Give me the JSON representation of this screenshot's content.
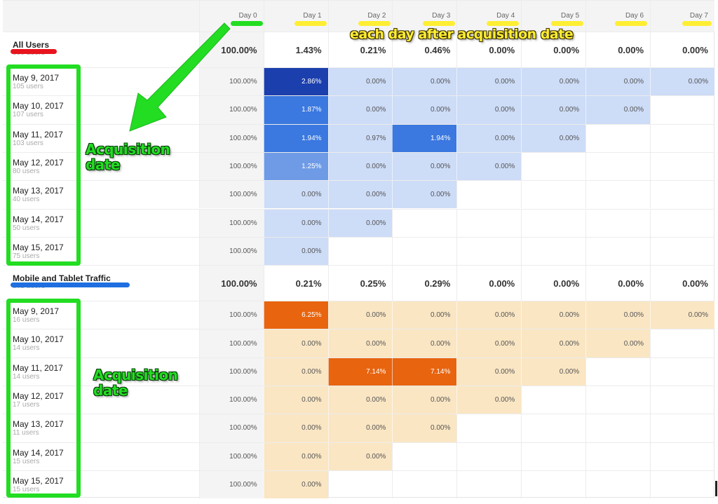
{
  "colors": {
    "blue_light": "#cddcf7",
    "blue_mid": "#6f9be6",
    "blue_strong": "#3b78e0",
    "blue_dark": "#1c3fae",
    "orange_light": "#fae6c3",
    "orange_strong": "#e8640f",
    "highlight_green": "#22dd22",
    "highlight_yellow": "#ffee33",
    "highlight_red": "#e8141e",
    "highlight_blue": "#1f6fe0"
  },
  "header": {
    "days": [
      "Day 0",
      "Day 1",
      "Day 2",
      "Day 3",
      "Day 4",
      "Day 5",
      "Day 6",
      "Day 7"
    ]
  },
  "segments": [
    {
      "title": "All Users",
      "users": "560 users",
      "summary": [
        "100.00%",
        "1.43%",
        "0.21%",
        "0.46%",
        "0.00%",
        "0.00%",
        "0.00%",
        "0.00%"
      ],
      "rows": [
        {
          "date": "May 9, 2017",
          "users": "105 users",
          "values": [
            "100.00%",
            "2.86%",
            "0.00%",
            "0.00%",
            "0.00%",
            "0.00%",
            "0.00%",
            "0.00%"
          ],
          "shades": [
            "",
            "dark",
            "light",
            "light",
            "light",
            "light",
            "light",
            "light"
          ]
        },
        {
          "date": "May 10, 2017",
          "users": "107 users",
          "values": [
            "100.00%",
            "1.87%",
            "0.00%",
            "0.00%",
            "0.00%",
            "0.00%",
            "0.00%"
          ],
          "shades": [
            "",
            "strong",
            "light",
            "light",
            "light",
            "light",
            "light"
          ]
        },
        {
          "date": "May 11, 2017",
          "users": "103 users",
          "values": [
            "100.00%",
            "1.94%",
            "0.97%",
            "1.94%",
            "0.00%",
            "0.00%"
          ],
          "shades": [
            "",
            "strong",
            "light",
            "strong",
            "light",
            "light"
          ]
        },
        {
          "date": "May 12, 2017",
          "users": "80 users",
          "values": [
            "100.00%",
            "1.25%",
            "0.00%",
            "0.00%",
            "0.00%"
          ],
          "shades": [
            "",
            "mid",
            "light",
            "light",
            "light"
          ]
        },
        {
          "date": "May 13, 2017",
          "users": "40 users",
          "values": [
            "100.00%",
            "0.00%",
            "0.00%",
            "0.00%"
          ],
          "shades": [
            "",
            "light",
            "light",
            "light"
          ]
        },
        {
          "date": "May 14, 2017",
          "users": "50 users",
          "values": [
            "100.00%",
            "0.00%",
            "0.00%"
          ],
          "shades": [
            "",
            "light",
            "light"
          ]
        },
        {
          "date": "May 15, 2017",
          "users": "75 users",
          "values": [
            "100.00%",
            "0.00%"
          ],
          "shades": [
            "",
            "light"
          ]
        }
      ]
    },
    {
      "title": "Mobile and Tablet Traffic",
      "users": "102 users",
      "summary": [
        "100.00%",
        "0.21%",
        "0.25%",
        "0.29%",
        "0.00%",
        "0.00%",
        "0.00%",
        "0.00%"
      ],
      "rows": [
        {
          "date": "May 9, 2017",
          "users": "16 users",
          "values": [
            "100.00%",
            "6.25%",
            "0.00%",
            "0.00%",
            "0.00%",
            "0.00%",
            "0.00%",
            "0.00%"
          ],
          "shades": [
            "",
            "ostrong",
            "olight",
            "olight",
            "olight",
            "olight",
            "olight",
            "olight"
          ]
        },
        {
          "date": "May 10, 2017",
          "users": "14 users",
          "values": [
            "100.00%",
            "0.00%",
            "0.00%",
            "0.00%",
            "0.00%",
            "0.00%",
            "0.00%"
          ],
          "shades": [
            "",
            "olight",
            "olight",
            "olight",
            "olight",
            "olight",
            "olight"
          ]
        },
        {
          "date": "May 11, 2017",
          "users": "14 users",
          "values": [
            "100.00%",
            "0.00%",
            "7.14%",
            "7.14%",
            "0.00%",
            "0.00%"
          ],
          "shades": [
            "",
            "olight",
            "ostrong",
            "ostrong",
            "olight",
            "olight"
          ]
        },
        {
          "date": "May 12, 2017",
          "users": "17 users",
          "values": [
            "100.00%",
            "0.00%",
            "0.00%",
            "0.00%",
            "0.00%"
          ],
          "shades": [
            "",
            "olight",
            "olight",
            "olight",
            "olight"
          ]
        },
        {
          "date": "May 13, 2017",
          "users": "11 users",
          "values": [
            "100.00%",
            "0.00%",
            "0.00%",
            "0.00%"
          ],
          "shades": [
            "",
            "olight",
            "olight",
            "olight"
          ]
        },
        {
          "date": "May 14, 2017",
          "users": "15 users",
          "values": [
            "100.00%",
            "0.00%",
            "0.00%"
          ],
          "shades": [
            "",
            "olight",
            "olight"
          ]
        },
        {
          "date": "May 15, 2017",
          "users": "15 users",
          "values": [
            "100.00%",
            "0.00%"
          ],
          "shades": [
            "",
            "olight"
          ]
        }
      ]
    }
  ],
  "annotations": {
    "top_caption": "each day after acquisition date",
    "side_caption_1": "Acquisition date",
    "side_caption_2": "Acquisition date"
  }
}
